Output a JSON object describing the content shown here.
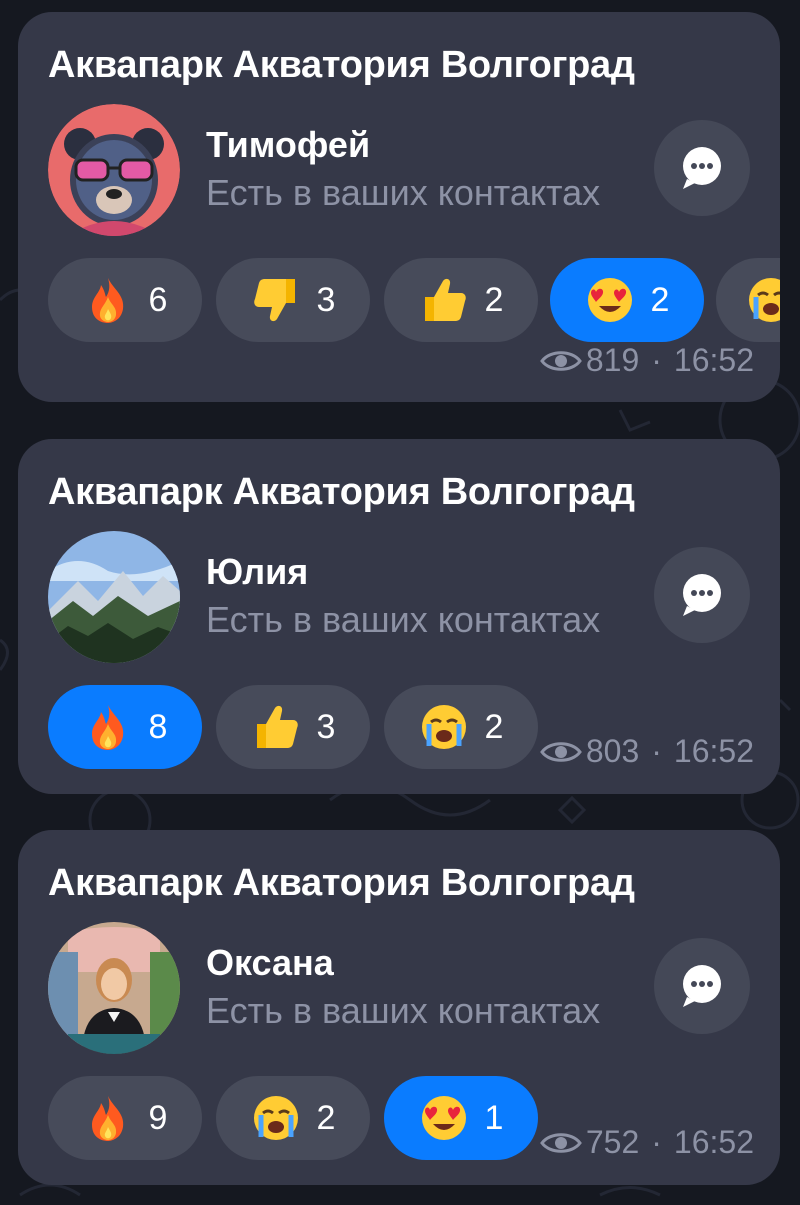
{
  "colors": {
    "background": "#151820",
    "card": "#353848",
    "reaction": "#474b5a",
    "reaction_active": "#0a7cff",
    "muted_text": "#8d92a5"
  },
  "posts": [
    {
      "channel_title": "Аквапарк Акватория Волгоград",
      "user_name": "Тимофей",
      "user_status": "Есть в ваших контактах",
      "avatar": "bear-with-glasses",
      "reactions": [
        {
          "emoji": "fire-icon",
          "count": "6",
          "active": false
        },
        {
          "emoji": "thumbs-down-icon",
          "count": "3",
          "active": false
        },
        {
          "emoji": "thumbs-up-icon",
          "count": "2",
          "active": false
        },
        {
          "emoji": "heart-eyes-icon",
          "count": "2",
          "active": true
        },
        {
          "emoji": "crying-icon",
          "count": "",
          "active": false
        }
      ],
      "views": "819",
      "separator": "·",
      "time": "16:52"
    },
    {
      "channel_title": "Аквапарк Акватория Волгоград",
      "user_name": "Юлия",
      "user_status": "Есть в ваших контактах",
      "avatar": "mountain-landscape",
      "reactions": [
        {
          "emoji": "fire-icon",
          "count": "8",
          "active": true
        },
        {
          "emoji": "thumbs-up-icon",
          "count": "3",
          "active": false
        },
        {
          "emoji": "crying-icon",
          "count": "2",
          "active": false
        }
      ],
      "views": "803",
      "separator": "·",
      "time": "16:52"
    },
    {
      "channel_title": "Аквапарк Акватория Волгоград",
      "user_name": "Оксана",
      "user_status": "Есть в ваших контактах",
      "avatar": "woman-in-classroom",
      "reactions": [
        {
          "emoji": "fire-icon",
          "count": "9",
          "active": false
        },
        {
          "emoji": "crying-icon",
          "count": "2",
          "active": false
        },
        {
          "emoji": "heart-eyes-icon",
          "count": "1",
          "active": true
        }
      ],
      "views": "752",
      "separator": "·",
      "time": "16:52"
    }
  ]
}
